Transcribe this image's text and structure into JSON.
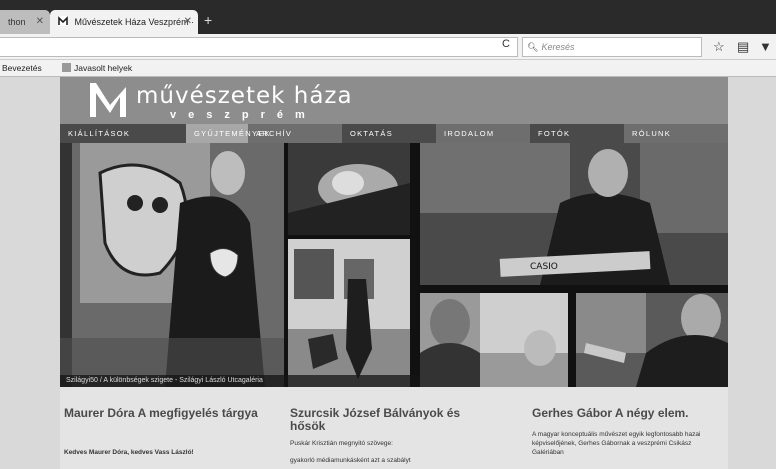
{
  "browser": {
    "tabs": [
      {
        "label": "thon",
        "active": false
      },
      {
        "label": "Művészetek Háza Veszprém ·",
        "active": true
      }
    ],
    "new_tab": "+",
    "search_placeholder": "Keresés",
    "bookmarks": [
      "Bevezetés",
      "Javasolt helyek"
    ]
  },
  "site": {
    "logo_title": "művészetek háza",
    "logo_sub": "veszprém",
    "menu": [
      "KIÁLLÍTÁSOK",
      "GYŰJTEMÉNYEK",
      "ARCHÍV",
      "OKTATÁS",
      "IRODALOM",
      "FOTÓK",
      "RÓLUNK"
    ],
    "caption": "Szilágyi50 / A különbségek szigete - Szilágyi László Utcagaléria",
    "articles": [
      {
        "title": "Maurer Dóra A megfigyelés tárgya",
        "text": "Kedves Maurer Dóra, kedves Vass László!"
      },
      {
        "title": "Szurcsik József Bálványok és hősök",
        "text": "Puskár Krisztián megnyitó szövege:",
        "text2": "gyakorló médiamunkásként azt a szabályt"
      },
      {
        "title": "Gerhes Gábor A négy elem.",
        "text": "A magyar konceptuális művészet egyik legfontosabb hazai képviselőjének, Gerhes Gábornak a veszprémi Csikász Galériában"
      }
    ]
  },
  "colors": {
    "header": "#8d8d8d",
    "menu": "#6e6e6e",
    "page_bg": "#d9d9d9"
  }
}
